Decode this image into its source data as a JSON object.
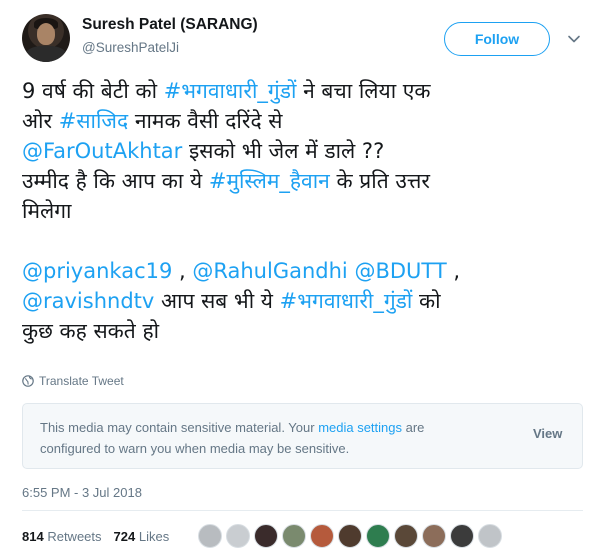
{
  "user": {
    "name": "Suresh Patel (SARANG)",
    "handle": "@SureshPatelJi"
  },
  "follow_label": "Follow",
  "tweet": {
    "l1_a": "9 वर्ष की बेटी को ",
    "l1_tag": "#भगवाधारी_गुंडों",
    "l1_b": " ने बचा लिया एक",
    "l2_a": "ओर ",
    "l2_tag": "#साजिद",
    "l2_b": " नामक वैसी दरिंदे से",
    "l3_mention": "@FarOutAkhtar",
    "l3_b": " इसको भी जेल में डाले ??",
    "l4_a": "उम्मीद है कि आप का ये ",
    "l4_tag": "#मुस्लिम_हैवान",
    "l4_b": " के प्रति उत्तर",
    "l5": "मिलेगा",
    "l6_m1": "@priyankac19",
    "l6_sep1": " , ",
    "l6_m2": "@RahulGandhi",
    "l6_sep2": " ",
    "l6_m3": "@BDUTT",
    "l6_sep3": " ,",
    "l7_m1": "@ravishndtv",
    "l7_b": " आप सब भी ये ",
    "l7_tag": "#भगवाधारी_गुंडों",
    "l7_c": " को",
    "l8": "कुछ कह सकते हो"
  },
  "translate_label": "Translate Tweet",
  "sensitive": {
    "text_a": "This media may contain sensitive material. Your ",
    "link": "media settings",
    "text_b": " are configured to warn you when media may be sensitive.",
    "view_label": "View"
  },
  "timestamp": "6:55 PM - 3 Jul 2018",
  "stats": {
    "retweets_count": "814",
    "retweets_label": "Retweets",
    "likes_count": "724",
    "likes_label": "Likes"
  },
  "likers": [
    "#b8bcc0",
    "#c9cdd1",
    "#3a2b2b",
    "#7a8a6e",
    "#b55a3c",
    "#4f3b2e",
    "#2e7d4f",
    "#5a4838",
    "#8c6d5a",
    "#3b3b3b",
    "#c0c4c8"
  ],
  "colors": {
    "accent": "#1da1f2",
    "muted": "#657786",
    "text": "#14171a"
  }
}
